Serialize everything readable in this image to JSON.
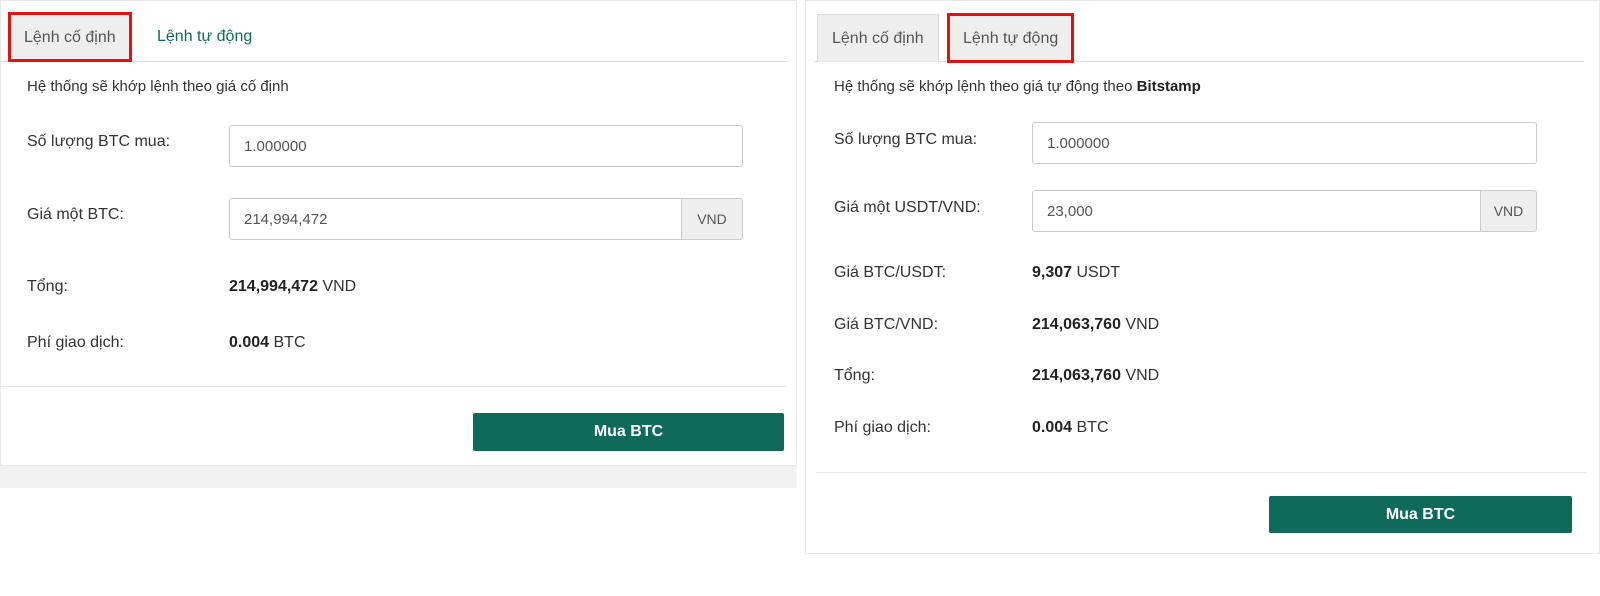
{
  "colors": {
    "accent": "#0e6b5a",
    "highlight": "#e31212",
    "tab_active_bg": "#eeeeee"
  },
  "left": {
    "tabs": [
      {
        "label": "Lệnh cố định",
        "active": true,
        "highlighted": true
      },
      {
        "label": "Lệnh tự động",
        "active": false,
        "highlighted": false
      }
    ],
    "description": "Hệ thống sẽ khớp lệnh theo giá cố định",
    "qty_label": "Số lượng BTC mua:",
    "qty_value": "1.000000",
    "price_label": "Giá một BTC:",
    "price_value": "214,994,472",
    "price_unit": "VND",
    "total_label": "Tổng:",
    "total_amount": "214,994,472",
    "total_unit": "VND",
    "fee_label": "Phí giao dịch:",
    "fee_amount": "0.004",
    "fee_unit": "BTC",
    "buy_button": "Mua BTC"
  },
  "right": {
    "tabs": [
      {
        "label": "Lệnh cố định",
        "active": false,
        "highlighted": false
      },
      {
        "label": "Lệnh tự động",
        "active": true,
        "highlighted": true
      }
    ],
    "description_prefix": "Hệ thống sẽ khớp lệnh theo giá tự động theo",
    "description_source": "Bitstamp",
    "qty_label": "Số lượng BTC mua:",
    "qty_value": "1.000000",
    "rate_label": "Giá một USDT/VND:",
    "rate_value": "23,000",
    "rate_unit": "VND",
    "btc_usdt_label": "Giá BTC/USDT:",
    "btc_usdt_amount": "9,307",
    "btc_usdt_unit": "USDT",
    "btc_vnd_label": "Giá BTC/VND:",
    "btc_vnd_amount": "214,063,760",
    "btc_vnd_unit": "VND",
    "total_label": "Tổng:",
    "total_amount": "214,063,760",
    "total_unit": "VND",
    "fee_label": "Phí giao dịch:",
    "fee_amount": "0.004",
    "fee_unit": "BTC",
    "buy_button": "Mua BTC"
  }
}
